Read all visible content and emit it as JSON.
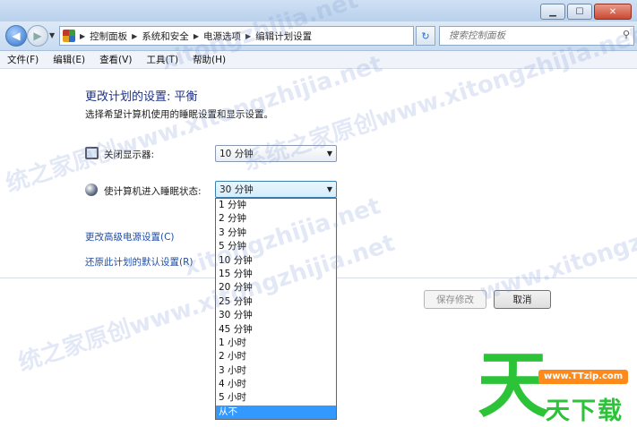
{
  "window": {
    "minimize_icon": "minimize-icon",
    "maximize_icon": "maximize-icon",
    "close_icon": "close-icon"
  },
  "address_bar": {
    "breadcrumbs": [
      "控制面板",
      "系统和安全",
      "电源选项",
      "编辑计划设置"
    ],
    "search_placeholder": "搜索控制面板"
  },
  "menubar": {
    "items": [
      "文件(F)",
      "编辑(E)",
      "查看(V)",
      "工具(T)",
      "帮助(H)"
    ]
  },
  "content": {
    "heading": "更改计划的设置: 平衡",
    "description": "选择希望计算机使用的睡眠设置和显示设置。",
    "display_off": {
      "label": "关闭显示器:",
      "value": "10 分钟"
    },
    "sleep": {
      "label": "使计算机进入睡眠状态:",
      "value": "30 分钟"
    },
    "links": {
      "advanced": "更改高级电源设置(C)",
      "restore": "还原此计划的默认设置(R)"
    },
    "buttons": {
      "save": "保存修改",
      "cancel": "取消"
    }
  },
  "sleep_options": [
    "1 分钟",
    "2 分钟",
    "3 分钟",
    "5 分钟",
    "10 分钟",
    "15 分钟",
    "20 分钟",
    "25 分钟",
    "30 分钟",
    "45 分钟",
    "1 小时",
    "2 小时",
    "3 小时",
    "4 小时",
    "5 小时",
    "从不"
  ],
  "sleep_highlighted_option": "从不",
  "watermark": {
    "text_a": "xitongzhijia.net",
    "text_b": "系统之家原创www.xitongzhijia.net",
    "text_c": "统之家原创www.xitongzhijia.net",
    "text_d": "www.xitongzhijia.n"
  },
  "brand": {
    "mark": "天",
    "url": "www.TTzip.com",
    "name": "天下载"
  },
  "colors": {
    "link": "#1f4ea8",
    "heading": "#1e3287",
    "highlight": "#3399ff",
    "brand_green": "#2cc338",
    "brand_orange": "#ff8a1c"
  }
}
